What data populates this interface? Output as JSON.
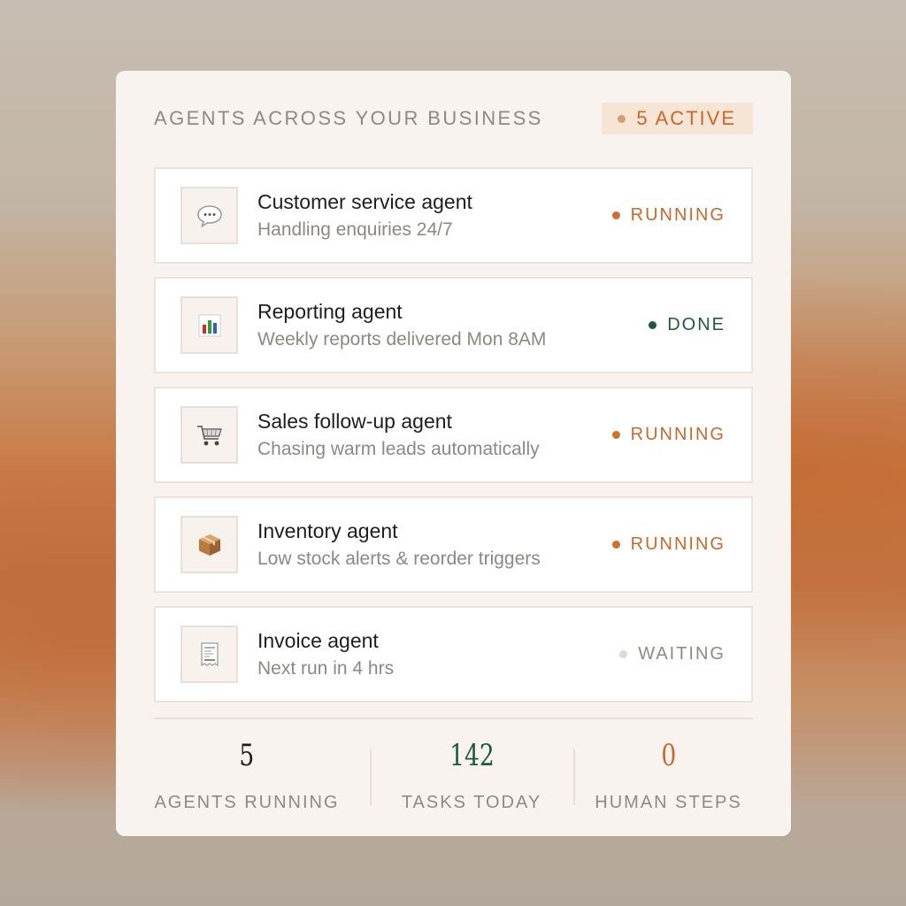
{
  "header": {
    "title": "AGENTS ACROSS YOUR BUSINESS",
    "active_label": "5 ACTIVE"
  },
  "agents": [
    {
      "icon": "speech-bubble-icon",
      "title": "Customer service agent",
      "subtitle": "Handling enquiries 24/7",
      "status": "RUNNING",
      "status_type": "running"
    },
    {
      "icon": "bar-chart-icon",
      "title": "Reporting agent",
      "subtitle": "Weekly reports delivered Mon 8AM",
      "status": "DONE",
      "status_type": "done"
    },
    {
      "icon": "shopping-cart-icon",
      "title": "Sales follow-up agent",
      "subtitle": "Chasing warm leads automatically",
      "status": "RUNNING",
      "status_type": "running"
    },
    {
      "icon": "package-icon",
      "title": "Inventory agent",
      "subtitle": "Low stock alerts & reorder triggers",
      "status": "RUNNING",
      "status_type": "running"
    },
    {
      "icon": "receipt-icon",
      "title": "Invoice agent",
      "subtitle": "Next run in 4 hrs",
      "status": "WAITING",
      "status_type": "waiting"
    }
  ],
  "stats": [
    {
      "value": "5",
      "label": "AGENTS RUNNING",
      "color": "#1e1e1e"
    },
    {
      "value": "142",
      "label": "TASKS TODAY",
      "color": "#1d5a3c"
    },
    {
      "value": "0",
      "label": "HUMAN STEPS",
      "color": "#c8692c"
    }
  ],
  "colors": {
    "running": "#c8692c",
    "done": "#1d5a3c",
    "waiting": "#8e8a82",
    "card_background": "#f8f3ef"
  }
}
